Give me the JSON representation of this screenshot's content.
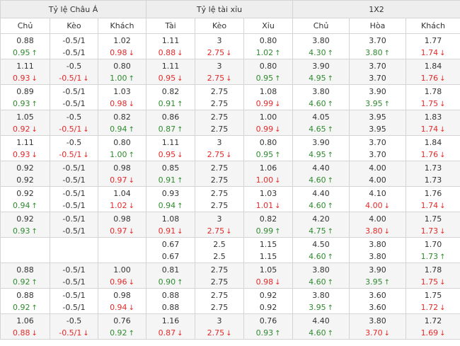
{
  "groups": [
    "Tỷ lệ Châu Á",
    "Tỷ lệ tài xỉu",
    "1X2"
  ],
  "columns": [
    "Chủ",
    "Kèo",
    "Khách",
    "Tài",
    "Kèo",
    "Xỉu",
    "Chủ",
    "Hòa",
    "Khách"
  ],
  "colors": {
    "up": "#2e8b2e",
    "down": "#e52929",
    "header_bg": "#eeeeee",
    "alt_row": "#f5f5f5"
  },
  "icons": {
    "up": "↑",
    "down": "↓"
  },
  "rows": [
    {
      "cells": [
        {
          "top": "0.88",
          "bottom": "0.95",
          "dir": "up"
        },
        {
          "top": "-0.5/1",
          "bottom": "-0.5/1",
          "dir": ""
        },
        {
          "top": "1.02",
          "bottom": "0.98",
          "dir": "down"
        },
        {
          "top": "1.11",
          "bottom": "0.88",
          "dir": "down"
        },
        {
          "top": "3",
          "bottom": "2.75",
          "dir": "down"
        },
        {
          "top": "0.80",
          "bottom": "1.02",
          "dir": "up"
        },
        {
          "top": "3.80",
          "bottom": "4.30",
          "dir": "up"
        },
        {
          "top": "3.70",
          "bottom": "3.80",
          "dir": "up"
        },
        {
          "top": "1.77",
          "bottom": "1.74",
          "dir": "down"
        }
      ]
    },
    {
      "cells": [
        {
          "top": "1.11",
          "bottom": "0.93",
          "dir": "down"
        },
        {
          "top": "-0.5",
          "bottom": "-0.5/1",
          "dir": "down"
        },
        {
          "top": "0.80",
          "bottom": "1.00",
          "dir": "up"
        },
        {
          "top": "1.11",
          "bottom": "0.95",
          "dir": "down"
        },
        {
          "top": "3",
          "bottom": "2.75",
          "dir": "down"
        },
        {
          "top": "0.80",
          "bottom": "0.95",
          "dir": "up"
        },
        {
          "top": "3.90",
          "bottom": "4.95",
          "dir": "up"
        },
        {
          "top": "3.70",
          "bottom": "3.70",
          "dir": ""
        },
        {
          "top": "1.84",
          "bottom": "1.76",
          "dir": "down"
        }
      ]
    },
    {
      "cells": [
        {
          "top": "0.89",
          "bottom": "0.93",
          "dir": "up"
        },
        {
          "top": "-0.5/1",
          "bottom": "-0.5/1",
          "dir": ""
        },
        {
          "top": "1.03",
          "bottom": "0.98",
          "dir": "down"
        },
        {
          "top": "0.82",
          "bottom": "0.91",
          "dir": "up"
        },
        {
          "top": "2.75",
          "bottom": "2.75",
          "dir": ""
        },
        {
          "top": "1.08",
          "bottom": "0.99",
          "dir": "down"
        },
        {
          "top": "3.80",
          "bottom": "4.60",
          "dir": "up"
        },
        {
          "top": "3.90",
          "bottom": "3.95",
          "dir": "up"
        },
        {
          "top": "1.78",
          "bottom": "1.75",
          "dir": "down"
        }
      ]
    },
    {
      "cells": [
        {
          "top": "1.05",
          "bottom": "0.92",
          "dir": "down"
        },
        {
          "top": "-0.5",
          "bottom": "-0.5/1",
          "dir": "down"
        },
        {
          "top": "0.82",
          "bottom": "0.94",
          "dir": "up"
        },
        {
          "top": "0.86",
          "bottom": "0.87",
          "dir": "up"
        },
        {
          "top": "2.75",
          "bottom": "2.75",
          "dir": ""
        },
        {
          "top": "1.00",
          "bottom": "0.99",
          "dir": "down"
        },
        {
          "top": "4.05",
          "bottom": "4.65",
          "dir": "up"
        },
        {
          "top": "3.95",
          "bottom": "3.95",
          "dir": ""
        },
        {
          "top": "1.83",
          "bottom": "1.74",
          "dir": "down"
        }
      ]
    },
    {
      "cells": [
        {
          "top": "1.11",
          "bottom": "0.93",
          "dir": "down"
        },
        {
          "top": "-0.5",
          "bottom": "-0.5/1",
          "dir": "down"
        },
        {
          "top": "0.80",
          "bottom": "1.00",
          "dir": "up"
        },
        {
          "top": "1.11",
          "bottom": "0.95",
          "dir": "down"
        },
        {
          "top": "3",
          "bottom": "2.75",
          "dir": "down"
        },
        {
          "top": "0.80",
          "bottom": "0.95",
          "dir": "up"
        },
        {
          "top": "3.90",
          "bottom": "4.95",
          "dir": "up"
        },
        {
          "top": "3.70",
          "bottom": "3.70",
          "dir": ""
        },
        {
          "top": "1.84",
          "bottom": "1.76",
          "dir": "down"
        }
      ]
    },
    {
      "cells": [
        {
          "top": "0.92",
          "bottom": "0.92",
          "dir": ""
        },
        {
          "top": "-0.5/1",
          "bottom": "-0.5/1",
          "dir": ""
        },
        {
          "top": "0.98",
          "bottom": "0.97",
          "dir": "down"
        },
        {
          "top": "0.85",
          "bottom": "0.91",
          "dir": "up"
        },
        {
          "top": "2.75",
          "bottom": "2.75",
          "dir": ""
        },
        {
          "top": "1.06",
          "bottom": "1.00",
          "dir": "down"
        },
        {
          "top": "4.40",
          "bottom": "4.60",
          "dir": "up"
        },
        {
          "top": "4.00",
          "bottom": "4.00",
          "dir": ""
        },
        {
          "top": "1.73",
          "bottom": "1.73",
          "dir": ""
        }
      ]
    },
    {
      "cells": [
        {
          "top": "0.92",
          "bottom": "0.94",
          "dir": "up"
        },
        {
          "top": "-0.5/1",
          "bottom": "-0.5/1",
          "dir": ""
        },
        {
          "top": "1.04",
          "bottom": "1.02",
          "dir": "down"
        },
        {
          "top": "0.93",
          "bottom": "0.94",
          "dir": "up"
        },
        {
          "top": "2.75",
          "bottom": "2.75",
          "dir": ""
        },
        {
          "top": "1.03",
          "bottom": "1.01",
          "dir": "down"
        },
        {
          "top": "4.40",
          "bottom": "4.60",
          "dir": "up"
        },
        {
          "top": "4.10",
          "bottom": "4.00",
          "dir": "down"
        },
        {
          "top": "1.76",
          "bottom": "1.74",
          "dir": "down"
        }
      ]
    },
    {
      "cells": [
        {
          "top": "0.92",
          "bottom": "0.93",
          "dir": "up"
        },
        {
          "top": "-0.5/1",
          "bottom": "-0.5/1",
          "dir": ""
        },
        {
          "top": "0.98",
          "bottom": "0.97",
          "dir": "down"
        },
        {
          "top": "1.08",
          "bottom": "0.91",
          "dir": "down"
        },
        {
          "top": "3",
          "bottom": "2.75",
          "dir": "down"
        },
        {
          "top": "0.82",
          "bottom": "0.99",
          "dir": "up"
        },
        {
          "top": "4.20",
          "bottom": "4.75",
          "dir": "up"
        },
        {
          "top": "4.00",
          "bottom": "3.80",
          "dir": "down"
        },
        {
          "top": "1.75",
          "bottom": "1.73",
          "dir": "down"
        }
      ]
    },
    {
      "cells": [
        {
          "top": "",
          "bottom": "",
          "dir": ""
        },
        {
          "top": "",
          "bottom": "",
          "dir": ""
        },
        {
          "top": "",
          "bottom": "",
          "dir": ""
        },
        {
          "top": "0.67",
          "bottom": "0.67",
          "dir": ""
        },
        {
          "top": "2.5",
          "bottom": "2.5",
          "dir": ""
        },
        {
          "top": "1.15",
          "bottom": "1.15",
          "dir": ""
        },
        {
          "top": "4.50",
          "bottom": "4.60",
          "dir": "up"
        },
        {
          "top": "3.80",
          "bottom": "3.80",
          "dir": ""
        },
        {
          "top": "1.70",
          "bottom": "1.73",
          "dir": "up"
        }
      ]
    },
    {
      "cells": [
        {
          "top": "0.88",
          "bottom": "0.92",
          "dir": "up"
        },
        {
          "top": "-0.5/1",
          "bottom": "-0.5/1",
          "dir": ""
        },
        {
          "top": "1.00",
          "bottom": "0.96",
          "dir": "down"
        },
        {
          "top": "0.81",
          "bottom": "0.90",
          "dir": "up"
        },
        {
          "top": "2.75",
          "bottom": "2.75",
          "dir": ""
        },
        {
          "top": "1.05",
          "bottom": "0.98",
          "dir": "down"
        },
        {
          "top": "3.80",
          "bottom": "4.60",
          "dir": "up"
        },
        {
          "top": "3.90",
          "bottom": "3.95",
          "dir": "up"
        },
        {
          "top": "1.78",
          "bottom": "1.75",
          "dir": "down"
        }
      ]
    },
    {
      "cells": [
        {
          "top": "0.88",
          "bottom": "0.92",
          "dir": "up"
        },
        {
          "top": "-0.5/1",
          "bottom": "-0.5/1",
          "dir": ""
        },
        {
          "top": "0.98",
          "bottom": "0.94",
          "dir": "down"
        },
        {
          "top": "0.88",
          "bottom": "0.88",
          "dir": ""
        },
        {
          "top": "2.75",
          "bottom": "2.75",
          "dir": ""
        },
        {
          "top": "0.92",
          "bottom": "0.92",
          "dir": ""
        },
        {
          "top": "3.80",
          "bottom": "3.95",
          "dir": "up"
        },
        {
          "top": "3.60",
          "bottom": "3.60",
          "dir": ""
        },
        {
          "top": "1.75",
          "bottom": "1.72",
          "dir": "down"
        }
      ]
    },
    {
      "cells": [
        {
          "top": "1.06",
          "bottom": "0.88",
          "dir": "down"
        },
        {
          "top": "-0.5",
          "bottom": "-0.5/1",
          "dir": "down"
        },
        {
          "top": "0.76",
          "bottom": "0.92",
          "dir": "up"
        },
        {
          "top": "1.16",
          "bottom": "0.87",
          "dir": "down"
        },
        {
          "top": "3",
          "bottom": "2.75",
          "dir": "down"
        },
        {
          "top": "0.76",
          "bottom": "0.93",
          "dir": "up"
        },
        {
          "top": "4.40",
          "bottom": "4.60",
          "dir": "up"
        },
        {
          "top": "3.80",
          "bottom": "3.70",
          "dir": "down"
        },
        {
          "top": "1.72",
          "bottom": "1.69",
          "dir": "down"
        }
      ]
    }
  ]
}
